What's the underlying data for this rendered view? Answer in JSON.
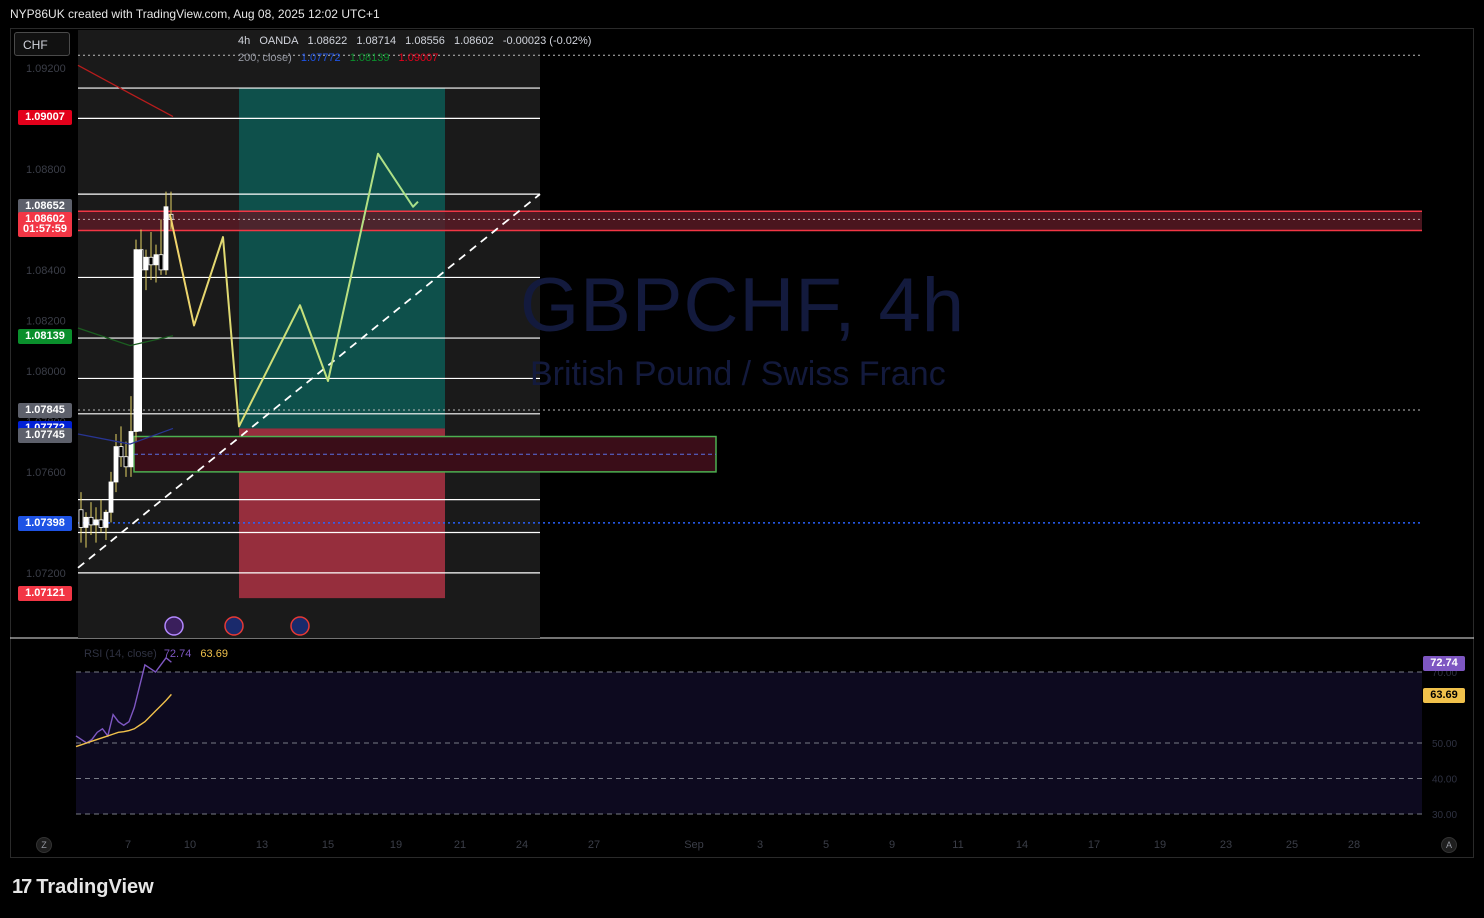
{
  "header": {
    "text": "NYP86UK created with TradingView.com, Aug 08, 2025 12:02 UTC+1"
  },
  "symbol_box": {
    "label": "CHF"
  },
  "legend": {
    "row1": [
      "4h",
      "OANDA",
      "1.08622",
      "1.08714",
      "1.08556",
      "1.08602",
      "-0.00023 (-0.02%)"
    ],
    "row2_prefix": "200, close)",
    "row2_values": [
      "1.07772",
      "1.08139",
      "1.09007"
    ]
  },
  "watermark": {
    "title": "GBPCHF, 4h",
    "subtitle": "British Pound / Swiss Franc"
  },
  "price_labels": [
    {
      "text": "1.09007",
      "color": "#e3001b",
      "price": 1.09007
    },
    {
      "text": "1.08652",
      "color": "#5d606b",
      "price": 1.08652
    },
    {
      "text": "1.08602",
      "color": "#f23645",
      "price": 1.08602
    },
    {
      "text": "01:57:59",
      "color": "#f23645",
      "price": 1.08562
    },
    {
      "text": "1.08139",
      "color": "#0a8f2c",
      "price": 1.08139
    },
    {
      "text": "1.07845",
      "color": "#5d606b",
      "price": 1.07845
    },
    {
      "text": "1.07772",
      "color": "#0020d6",
      "price": 1.07772
    },
    {
      "text": "1.07745",
      "color": "#5d606b",
      "price": 1.07745
    },
    {
      "text": "1.07398",
      "color": "#1e53e5",
      "price": 1.07398
    },
    {
      "text": "1.07121",
      "color": "#f23645",
      "price": 1.07121
    }
  ],
  "chart_data": {
    "type": "candlestick",
    "symbol": "GBPCHF",
    "interval": "4h",
    "ylim": [
      1.0695,
      1.0935
    ],
    "price_ticks": [
      "1.09200",
      "1.08800",
      "1.08600",
      "1.08400",
      "1.08200",
      "1.08000",
      "1.07800",
      "1.07600",
      "1.07200"
    ],
    "x_ticks": [
      "7",
      "10",
      "13",
      "15",
      "19",
      "21",
      "24",
      "27",
      "Sep",
      "3",
      "5",
      "9",
      "11",
      "14",
      "17",
      "19",
      "23",
      "25",
      "28"
    ],
    "candles": [
      [
        1.0745,
        1.0752,
        1.0732,
        1.0738
      ],
      [
        1.0738,
        1.0744,
        1.073,
        1.0742
      ],
      [
        1.0742,
        1.0748,
        1.0735,
        1.0739
      ],
      [
        1.0739,
        1.0746,
        1.0732,
        1.0741
      ],
      [
        1.0741,
        1.0749,
        1.0736,
        1.0738
      ],
      [
        1.0738,
        1.0745,
        1.0733,
        1.0744
      ],
      [
        1.0744,
        1.076,
        1.074,
        1.0756
      ],
      [
        1.0756,
        1.0775,
        1.0752,
        1.077
      ],
      [
        1.077,
        1.0778,
        1.0762,
        1.0766
      ],
      [
        1.0766,
        1.0772,
        1.0758,
        1.0762
      ],
      [
        1.0762,
        1.079,
        1.0758,
        1.0776
      ],
      [
        1.0776,
        1.0852,
        1.0772,
        1.0848
      ],
      [
        1.0848,
        1.0856,
        1.083,
        1.084
      ],
      [
        1.084,
        1.0848,
        1.0832,
        1.0845
      ],
      [
        1.0845,
        1.0855,
        1.0836,
        1.0842
      ],
      [
        1.0842,
        1.085,
        1.0835,
        1.0846
      ],
      [
        1.0846,
        1.086,
        1.0838,
        1.084
      ],
      [
        1.084,
        1.0871,
        1.0838,
        1.0865
      ],
      [
        1.0862,
        1.0871,
        1.0856,
        1.086
      ]
    ],
    "ma_values": {
      "ma_blue": 1.07772,
      "ma_green": 1.08139,
      "ma_red": 1.09007
    },
    "projection_path": [
      1.0862,
      1.0818,
      1.0853,
      1.0778,
      1.0826,
      1.0796,
      1.0886,
      1.0865,
      1.0867
    ],
    "position": {
      "target": 1.0912,
      "entry": 1.07772,
      "stop": 1.071
    },
    "levels": [
      1.0912,
      1.09,
      1.087,
      1.0837,
      1.0813,
      1.0797,
      1.0783,
      1.0749,
      1.0736,
      1.072
    ],
    "resistance_zone": [
      1.08556,
      1.08632
    ],
    "demand_zone": [
      1.076,
      1.0774
    ],
    "dotted_levels": [
      1.0925,
      1.07845,
      1.07398
    ],
    "rsi": {
      "length": 14,
      "value": 72.74,
      "ma_value": 63.69,
      "levels": [
        "70.00",
        "50.00",
        "40.00",
        "30.00"
      ],
      "series": [
        52,
        51,
        50,
        51,
        53,
        54,
        52,
        58,
        56,
        55,
        56,
        60,
        66,
        72,
        71,
        70,
        72,
        74,
        72.74
      ],
      "ma_series": [
        49,
        49.5,
        50,
        50.5,
        51,
        51.5,
        52,
        52.5,
        53,
        53.2,
        53.5,
        54,
        55,
        56,
        57.5,
        59,
        60.5,
        62,
        63.69
      ]
    }
  },
  "rsi_legend": {
    "label": "RSI (14, close)",
    "v1": "72.74",
    "v2": "63.69"
  },
  "rsi_labels": [
    {
      "text": "72.74",
      "color": "#7e57c2"
    },
    {
      "text": "63.69",
      "color": "#f0c14b"
    }
  ],
  "event_icons": [
    "lightning-icon",
    "uk-flag-icon",
    "uk-flag-icon"
  ],
  "buttons": {
    "left": "Z",
    "right": "A"
  },
  "footer": {
    "brand": "TradingView",
    "mark": "17"
  }
}
